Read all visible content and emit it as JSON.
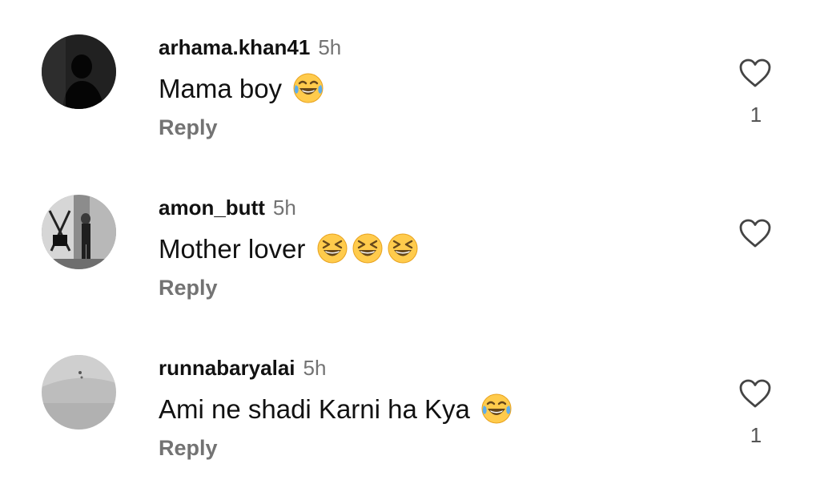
{
  "comments": [
    {
      "username": "arhama.khan41",
      "time": "5h",
      "text": "Mama boy",
      "emojis": [
        "tears-of-joy"
      ],
      "reply_label": "Reply",
      "likes": "1",
      "avatar": "dark-silhouette"
    },
    {
      "username": "amon_butt",
      "time": "5h",
      "text": "Mother lover",
      "emojis": [
        "grinning-squinting",
        "grinning-squinting",
        "grinning-squinting"
      ],
      "reply_label": "Reply",
      "likes": "",
      "avatar": "grayscale-photo"
    },
    {
      "username": "runnabaryalai",
      "time": "5h",
      "text": "Ami ne shadi Karni ha Kya",
      "emojis": [
        "tears-of-joy"
      ],
      "reply_label": "Reply",
      "likes": "1",
      "avatar": "gray-wall"
    }
  ],
  "colors": {
    "username": "#111111",
    "meta": "#737373",
    "emoji_face": "#FFCB4C",
    "emoji_tear": "#5DADEC"
  }
}
